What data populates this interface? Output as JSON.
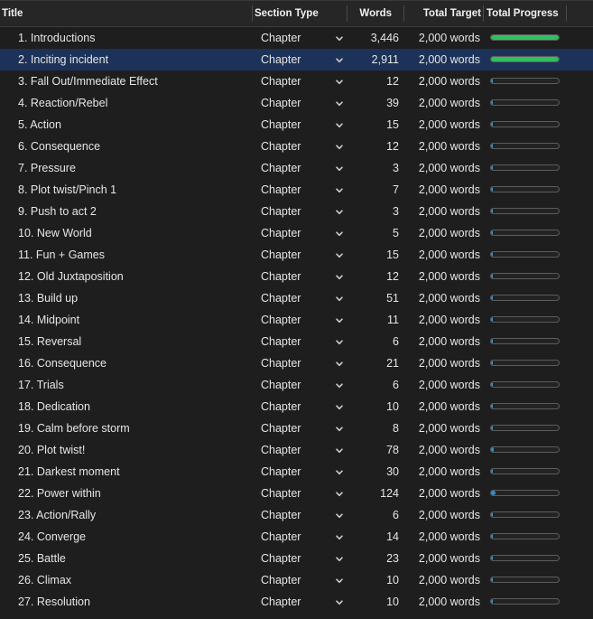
{
  "header": {
    "title": "Title",
    "section_type": "Section Type",
    "words": "Words",
    "total_target": "Total Target",
    "total_progress": "Total Progress"
  },
  "rows": [
    {
      "title": "1. Introductions",
      "type": "Chapter",
      "words": "3,446",
      "target": "2,000 words",
      "progress": 1.0,
      "selected": false
    },
    {
      "title": "2. Inciting incident",
      "type": "Chapter",
      "words": "2,911",
      "target": "2,000 words",
      "progress": 1.0,
      "selected": true
    },
    {
      "title": "3. Fall Out/Immediate Effect",
      "type": "Chapter",
      "words": "12",
      "target": "2,000 words",
      "progress": 0.006,
      "selected": false
    },
    {
      "title": "4. Reaction/Rebel",
      "type": "Chapter",
      "words": "39",
      "target": "2,000 words",
      "progress": 0.0195,
      "selected": false
    },
    {
      "title": "5. Action",
      "type": "Chapter",
      "words": "15",
      "target": "2,000 words",
      "progress": 0.0075,
      "selected": false
    },
    {
      "title": "6. Consequence",
      "type": "Chapter",
      "words": "12",
      "target": "2,000 words",
      "progress": 0.006,
      "selected": false
    },
    {
      "title": "7. Pressure",
      "type": "Chapter",
      "words": "3",
      "target": "2,000 words",
      "progress": 0.0015,
      "selected": false
    },
    {
      "title": "8. Plot twist/Pinch 1",
      "type": "Chapter",
      "words": "7",
      "target": "2,000 words",
      "progress": 0.0035,
      "selected": false
    },
    {
      "title": "9. Push to act 2",
      "type": "Chapter",
      "words": "3",
      "target": "2,000 words",
      "progress": 0.0015,
      "selected": false
    },
    {
      "title": "10. New World",
      "type": "Chapter",
      "words": "5",
      "target": "2,000 words",
      "progress": 0.0025,
      "selected": false
    },
    {
      "title": "11. Fun + Games",
      "type": "Chapter",
      "words": "15",
      "target": "2,000 words",
      "progress": 0.0075,
      "selected": false
    },
    {
      "title": "12. Old Juxtaposition",
      "type": "Chapter",
      "words": "12",
      "target": "2,000 words",
      "progress": 0.006,
      "selected": false
    },
    {
      "title": "13. Build up",
      "type": "Chapter",
      "words": "51",
      "target": "2,000 words",
      "progress": 0.0255,
      "selected": false
    },
    {
      "title": "14. Midpoint",
      "type": "Chapter",
      "words": "11",
      "target": "2,000 words",
      "progress": 0.0055,
      "selected": false
    },
    {
      "title": "15. Reversal",
      "type": "Chapter",
      "words": "6",
      "target": "2,000 words",
      "progress": 0.003,
      "selected": false
    },
    {
      "title": "16. Consequence",
      "type": "Chapter",
      "words": "21",
      "target": "2,000 words",
      "progress": 0.0105,
      "selected": false
    },
    {
      "title": "17. Trials",
      "type": "Chapter",
      "words": "6",
      "target": "2,000 words",
      "progress": 0.003,
      "selected": false
    },
    {
      "title": "18. Dedication",
      "type": "Chapter",
      "words": "10",
      "target": "2,000 words",
      "progress": 0.005,
      "selected": false
    },
    {
      "title": "19. Calm before storm",
      "type": "Chapter",
      "words": "8",
      "target": "2,000 words",
      "progress": 0.004,
      "selected": false
    },
    {
      "title": "20. Plot twist!",
      "type": "Chapter",
      "words": "78",
      "target": "2,000 words",
      "progress": 0.039,
      "selected": false
    },
    {
      "title": "21. Darkest moment",
      "type": "Chapter",
      "words": "30",
      "target": "2,000 words",
      "progress": 0.015,
      "selected": false
    },
    {
      "title": "22. Power within",
      "type": "Chapter",
      "words": "124",
      "target": "2,000 words",
      "progress": 0.062,
      "selected": false
    },
    {
      "title": "23. Action/Rally",
      "type": "Chapter",
      "words": "6",
      "target": "2,000 words",
      "progress": 0.003,
      "selected": false
    },
    {
      "title": "24. Converge",
      "type": "Chapter",
      "words": "14",
      "target": "2,000 words",
      "progress": 0.007,
      "selected": false
    },
    {
      "title": "25. Battle",
      "type": "Chapter",
      "words": "23",
      "target": "2,000 words",
      "progress": 0.0115,
      "selected": false
    },
    {
      "title": "26. Climax",
      "type": "Chapter",
      "words": "10",
      "target": "2,000 words",
      "progress": 0.005,
      "selected": false
    },
    {
      "title": "27. Resolution",
      "type": "Chapter",
      "words": "10",
      "target": "2,000 words",
      "progress": 0.005,
      "selected": false
    }
  ],
  "icons": {
    "dropdown": "chevron-down-icon"
  },
  "colors": {
    "progress_complete": "#30c060",
    "progress_partial": "#2f8fd0",
    "selection": "#1c3259"
  }
}
